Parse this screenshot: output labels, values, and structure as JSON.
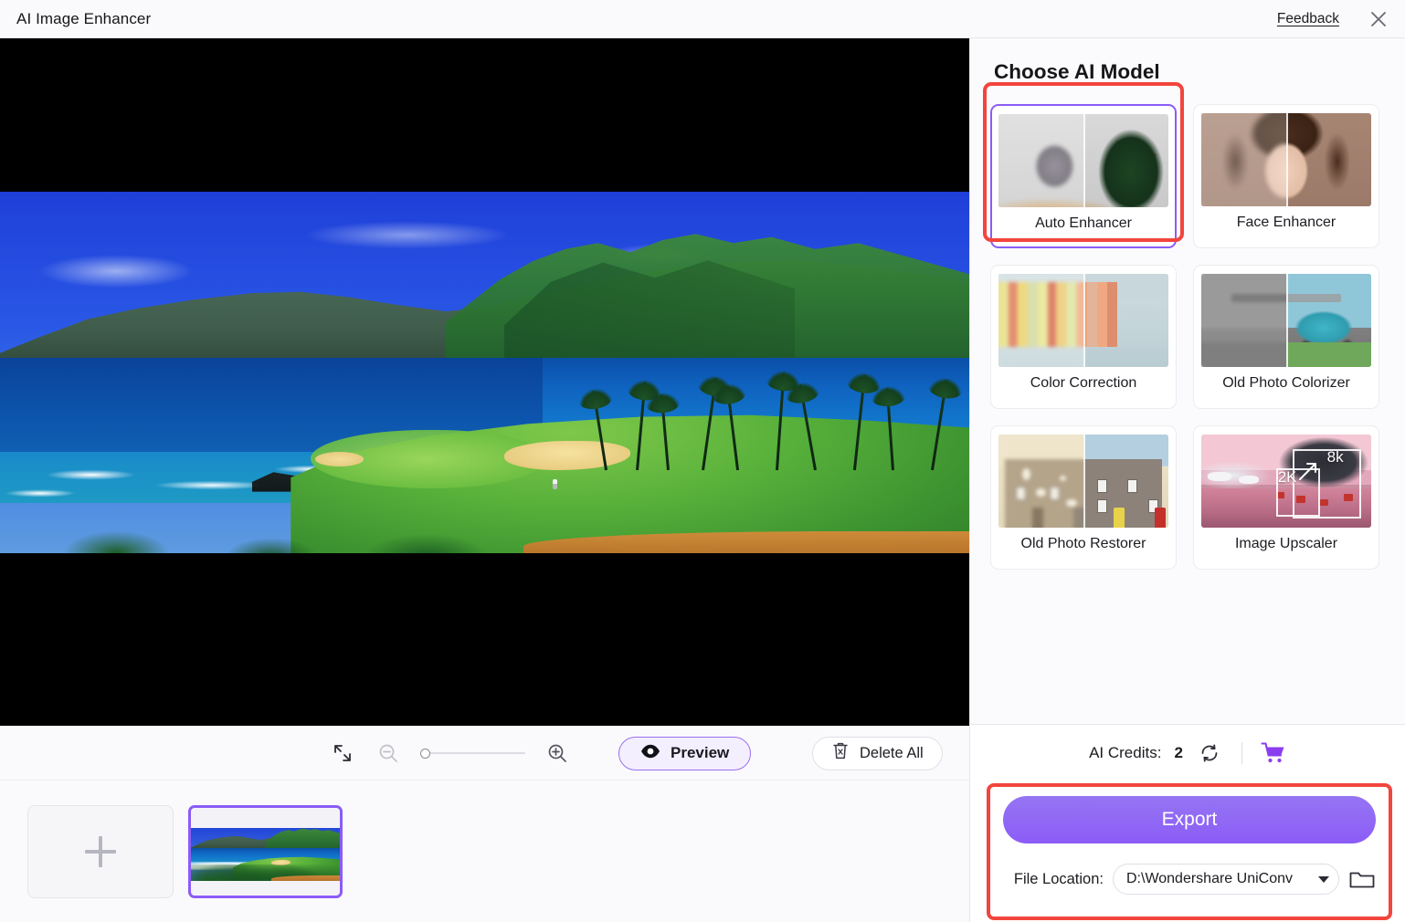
{
  "window": {
    "title": "AI Image Enhancer",
    "feedback_label": "Feedback",
    "close_icon": "close-icon"
  },
  "canvas": {
    "image_alt": "Coastal golf course with ocean and mountains",
    "background_color": "#000000"
  },
  "toolbar": {
    "fit_icon": "fit-to-screen-icon",
    "zoom_out_icon": "zoom-out-icon",
    "zoom_in_icon": "zoom-in-icon",
    "zoom_value": 0,
    "preview_label": "Preview",
    "preview_icon": "eye-icon",
    "delete_all_label": "Delete All",
    "delete_icon": "trash-icon"
  },
  "thumbnails": {
    "add_label": "+",
    "add_icon": "plus-icon",
    "items": [
      {
        "name": "coastal-golf-course",
        "selected": true
      }
    ]
  },
  "models_panel": {
    "title": "Choose AI Model",
    "selected": "Auto Enhancer",
    "highlight_color": "#f2453d",
    "selection_color": "#8b5cf6",
    "items": [
      {
        "label": "Auto Enhancer",
        "thumb": "cat-christmas-tree",
        "selected": true,
        "highlighted": true
      },
      {
        "label": "Face Enhancer",
        "thumb": "woman-portrait",
        "selected": false,
        "highlighted": false
      },
      {
        "label": "Color Correction",
        "thumb": "colorful-town",
        "selected": false,
        "highlighted": false
      },
      {
        "label": "Old Photo Colorizer",
        "thumb": "vintage-beetle-car",
        "selected": false,
        "highlighted": false
      },
      {
        "label": "Old Photo Restorer",
        "thumb": "old-brick-houses",
        "selected": false,
        "highlighted": false
      },
      {
        "label": "Image Upscaler",
        "thumb": "snowy-village",
        "selected": false,
        "highlighted": false,
        "badges": [
          "2K",
          "8k"
        ]
      }
    ]
  },
  "footer": {
    "credits_label": "AI Credits:",
    "credits_value": "2",
    "refresh_icon": "refresh-icon",
    "cart_icon": "shopping-cart-icon",
    "export_label": "Export",
    "export_color": "#8b5cf6",
    "file_location_label": "File Location:",
    "file_location_value": "D:\\Wondershare UniConv",
    "browse_icon": "folder-icon",
    "dropdown_icon": "chevron-down-icon"
  }
}
